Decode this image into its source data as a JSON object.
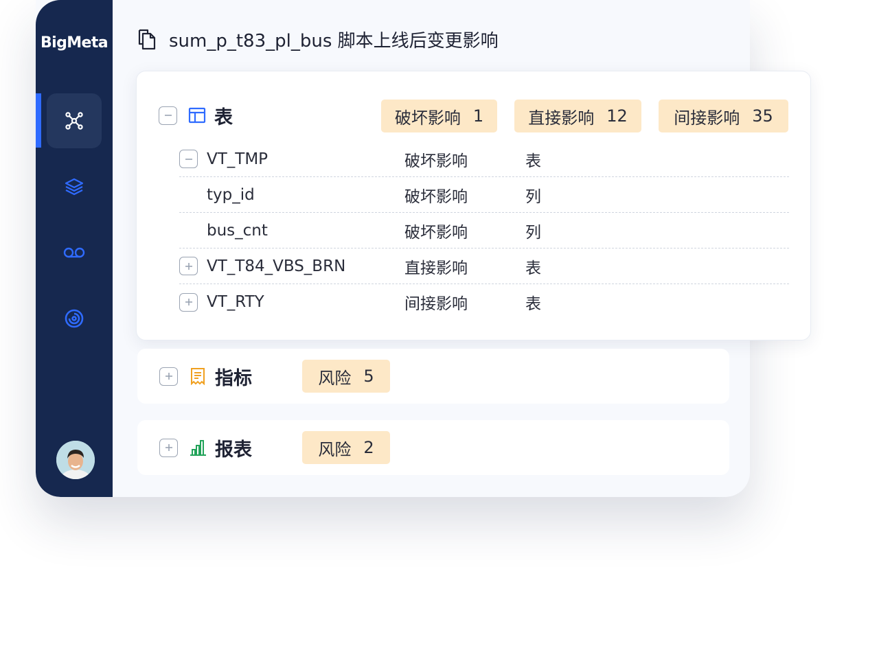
{
  "brand": "BigMeta",
  "header": {
    "title": "sum_p_t83_pl_bus  脚本上线后变更影响"
  },
  "table_section": {
    "title": "表",
    "badges": [
      {
        "label": "破坏影响",
        "count": "1"
      },
      {
        "label": "直接影响",
        "count": "12"
      },
      {
        "label": "间接影响",
        "count": "35"
      }
    ],
    "rows": [
      {
        "name": "VT_TMP",
        "impact": "破坏影响",
        "type": "表",
        "toggle": "minus"
      },
      {
        "name": "typ_id",
        "impact": "破坏影响",
        "type": "列",
        "toggle": "none"
      },
      {
        "name": "bus_cnt",
        "impact": "破坏影响",
        "type": "列",
        "toggle": "none"
      },
      {
        "name": "VT_T84_VBS_BRN",
        "impact": "直接影响",
        "type": "表",
        "toggle": "plus"
      },
      {
        "name": "VT_RTY",
        "impact": "间接影响",
        "type": "表",
        "toggle": "plus"
      }
    ]
  },
  "metric_section": {
    "title": "指标",
    "badge": {
      "label": "风险",
      "count": "5"
    }
  },
  "report_section": {
    "title": "报表",
    "badge": {
      "label": "风险",
      "count": "2"
    }
  },
  "nav": [
    {
      "icon": "graph-nodes-icon",
      "active": true
    },
    {
      "icon": "layers-icon",
      "active": false
    },
    {
      "icon": "infinity-link-icon",
      "active": false
    },
    {
      "icon": "target-icon",
      "active": false
    }
  ],
  "colors": {
    "sidebar": "#16284f",
    "accent": "#2f6bff",
    "badge_bg": "#fde8c7",
    "table_icon": "#2f6bff",
    "metric_icon": "#f0a020",
    "report_icon": "#22a35a"
  }
}
